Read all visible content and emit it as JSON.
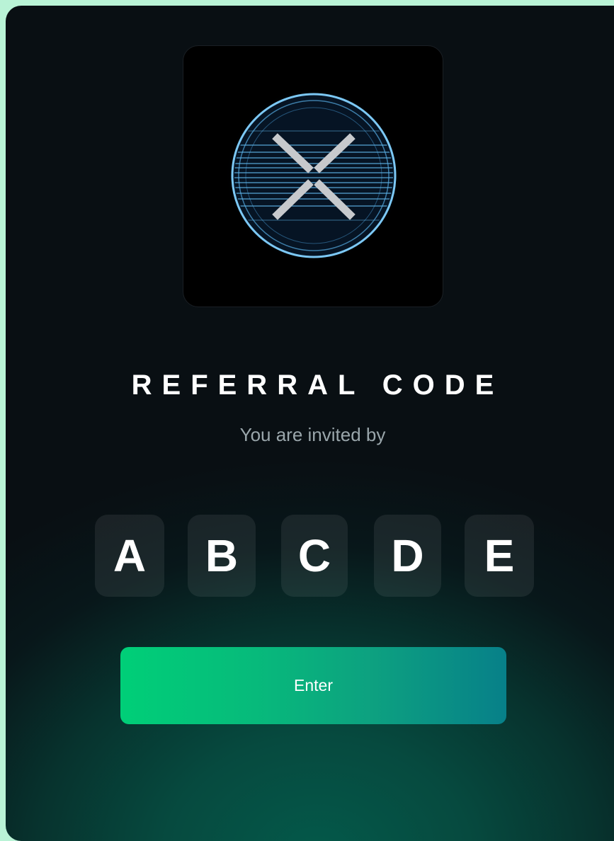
{
  "logo": {
    "icon": "xrp-logo-icon"
  },
  "referral": {
    "title": "REFERRAL CODE",
    "subtitle": "You are invited by",
    "code": [
      "A",
      "B",
      "C",
      "D",
      "E"
    ]
  },
  "actions": {
    "enter_label": "Enter"
  },
  "colors": {
    "page_border": "#b9f3d6",
    "panel_dark": "#090f13",
    "glow_green": "#04594a",
    "button_start": "#00cf78",
    "button_end": "#078089",
    "logo_ring": "#5fb4ea"
  }
}
